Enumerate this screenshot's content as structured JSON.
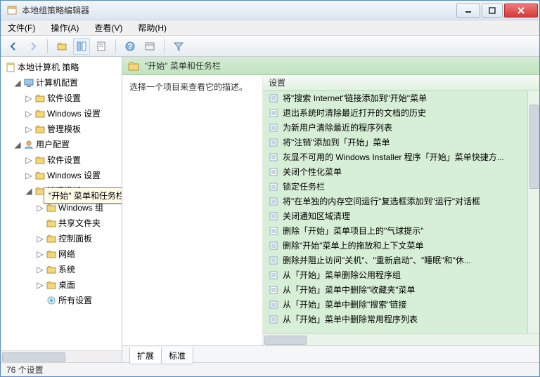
{
  "window": {
    "title": "本地组策略编辑器"
  },
  "menu": {
    "file": "文件(F)",
    "action": "操作(A)",
    "view": "查看(V)",
    "help": "帮助(H)"
  },
  "tree": {
    "root": "本地计算机 策略",
    "computer": "计算机配置",
    "user": "用户配置",
    "software": "软件设置",
    "windows_settings": "Windows 设置",
    "admin_templates": "管理模板",
    "windows_components": "Windows 组",
    "shared_folders": "共享文件夹",
    "control_panel": "控制面板",
    "network": "网络",
    "system": "系统",
    "desktop": "桌面",
    "all_settings": "所有设置"
  },
  "tooltip": {
    "text": "\"开始\" 菜单和任务栏"
  },
  "right": {
    "header": "\"开始\" 菜单和任务栏",
    "desc": "选择一个项目来查看它的描述。",
    "col_setting": "设置",
    "items": [
      "将\"搜索 Internet\"链接添加到\"开始\"菜单",
      "退出系统时清除最近打开的文档的历史",
      "为新用户清除最近的程序列表",
      "将\"注销\"添加到「开始」菜单",
      "灰显不可用的 Windows Installer 程序「开始」菜单快捷方...",
      "关闭个性化菜单",
      "锁定任务栏",
      "将\"在单独的内存空间运行\"复选框添加到\"运行\"对话框",
      "关闭通知区域清理",
      "删除「开始」菜单项目上的\"气球提示\"",
      "删除\"开始\"菜单上的拖放和上下文菜单",
      "删除并阻止访问\"关机\"、\"重新启动\"、\"睡眠\"和\"休...",
      "从「开始」菜单删除公用程序组",
      "从「开始」菜单中删除\"收藏夹\"菜单",
      "从「开始」菜单中删除\"搜索\"链接",
      "从「开始」菜单中删除常用程序列表"
    ]
  },
  "tabs": {
    "extended": "扩展",
    "standard": "标准"
  },
  "status": {
    "text": "76 个设置"
  }
}
